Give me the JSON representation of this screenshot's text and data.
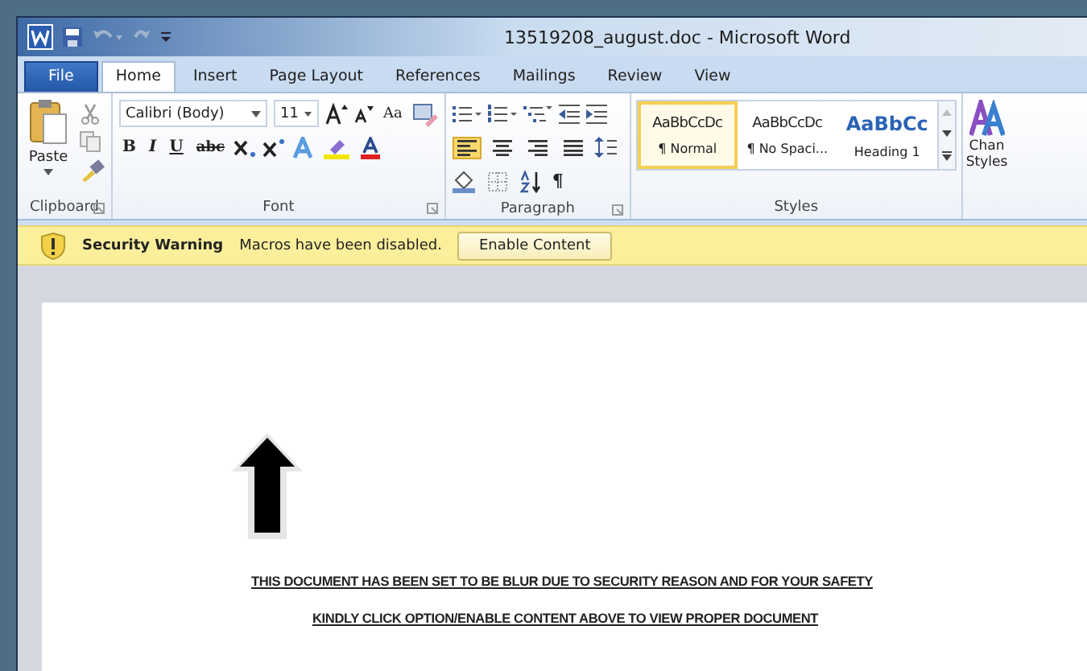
{
  "window": {
    "title": "13519208_august.doc - Microsoft Word"
  },
  "tabs": [
    {
      "label": "File",
      "kind": "file",
      "selected": false
    },
    {
      "label": "Home",
      "kind": "tab",
      "selected": true
    },
    {
      "label": "Insert",
      "kind": "tab",
      "selected": false
    },
    {
      "label": "Page Layout",
      "kind": "tab",
      "selected": false
    },
    {
      "label": "References",
      "kind": "tab",
      "selected": false
    },
    {
      "label": "Mailings",
      "kind": "tab",
      "selected": false
    },
    {
      "label": "Review",
      "kind": "tab",
      "selected": false
    },
    {
      "label": "View",
      "kind": "tab",
      "selected": false
    }
  ],
  "clipboard": {
    "paste_label": "Paste",
    "label": "Clipboard"
  },
  "font": {
    "font_name": "Calibri (Body)",
    "font_size": "11",
    "case_button": "Aa",
    "format_buttons": [
      "B",
      "I",
      "U",
      "abc"
    ],
    "label": "Font"
  },
  "paragraph": {
    "alignments": [
      {
        "selected": true
      },
      {
        "selected": false
      },
      {
        "selected": false
      },
      {
        "selected": false
      }
    ],
    "pilcrow": "¶",
    "label": "Paragraph"
  },
  "styles": {
    "items": [
      {
        "preview": "AaBbCcDc",
        "name": "¶ Normal",
        "kind": "body",
        "selected": true
      },
      {
        "preview": "AaBbCcDc",
        "name": "¶ No Spaci...",
        "kind": "body",
        "selected": false
      },
      {
        "preview": "AaBbCc",
        "name": "Heading 1",
        "kind": "heading",
        "selected": false
      }
    ],
    "label": "Styles"
  },
  "change_styles": [
    "Chan",
    "Styles"
  ],
  "security_bar": {
    "title": "Security Warning",
    "message": "Macros have been disabled.",
    "button": "Enable Content"
  },
  "document": {
    "lines": [
      "THIS DOCUMENT HAS BEEN SET TO BE BLUR DUE TO SECURITY REASON AND FOR YOUR SAFETY",
      "KINDLY CLICK OPTION/ENABLE CONTENT ABOVE TO VIEW PROPER DOCUMENT"
    ]
  }
}
